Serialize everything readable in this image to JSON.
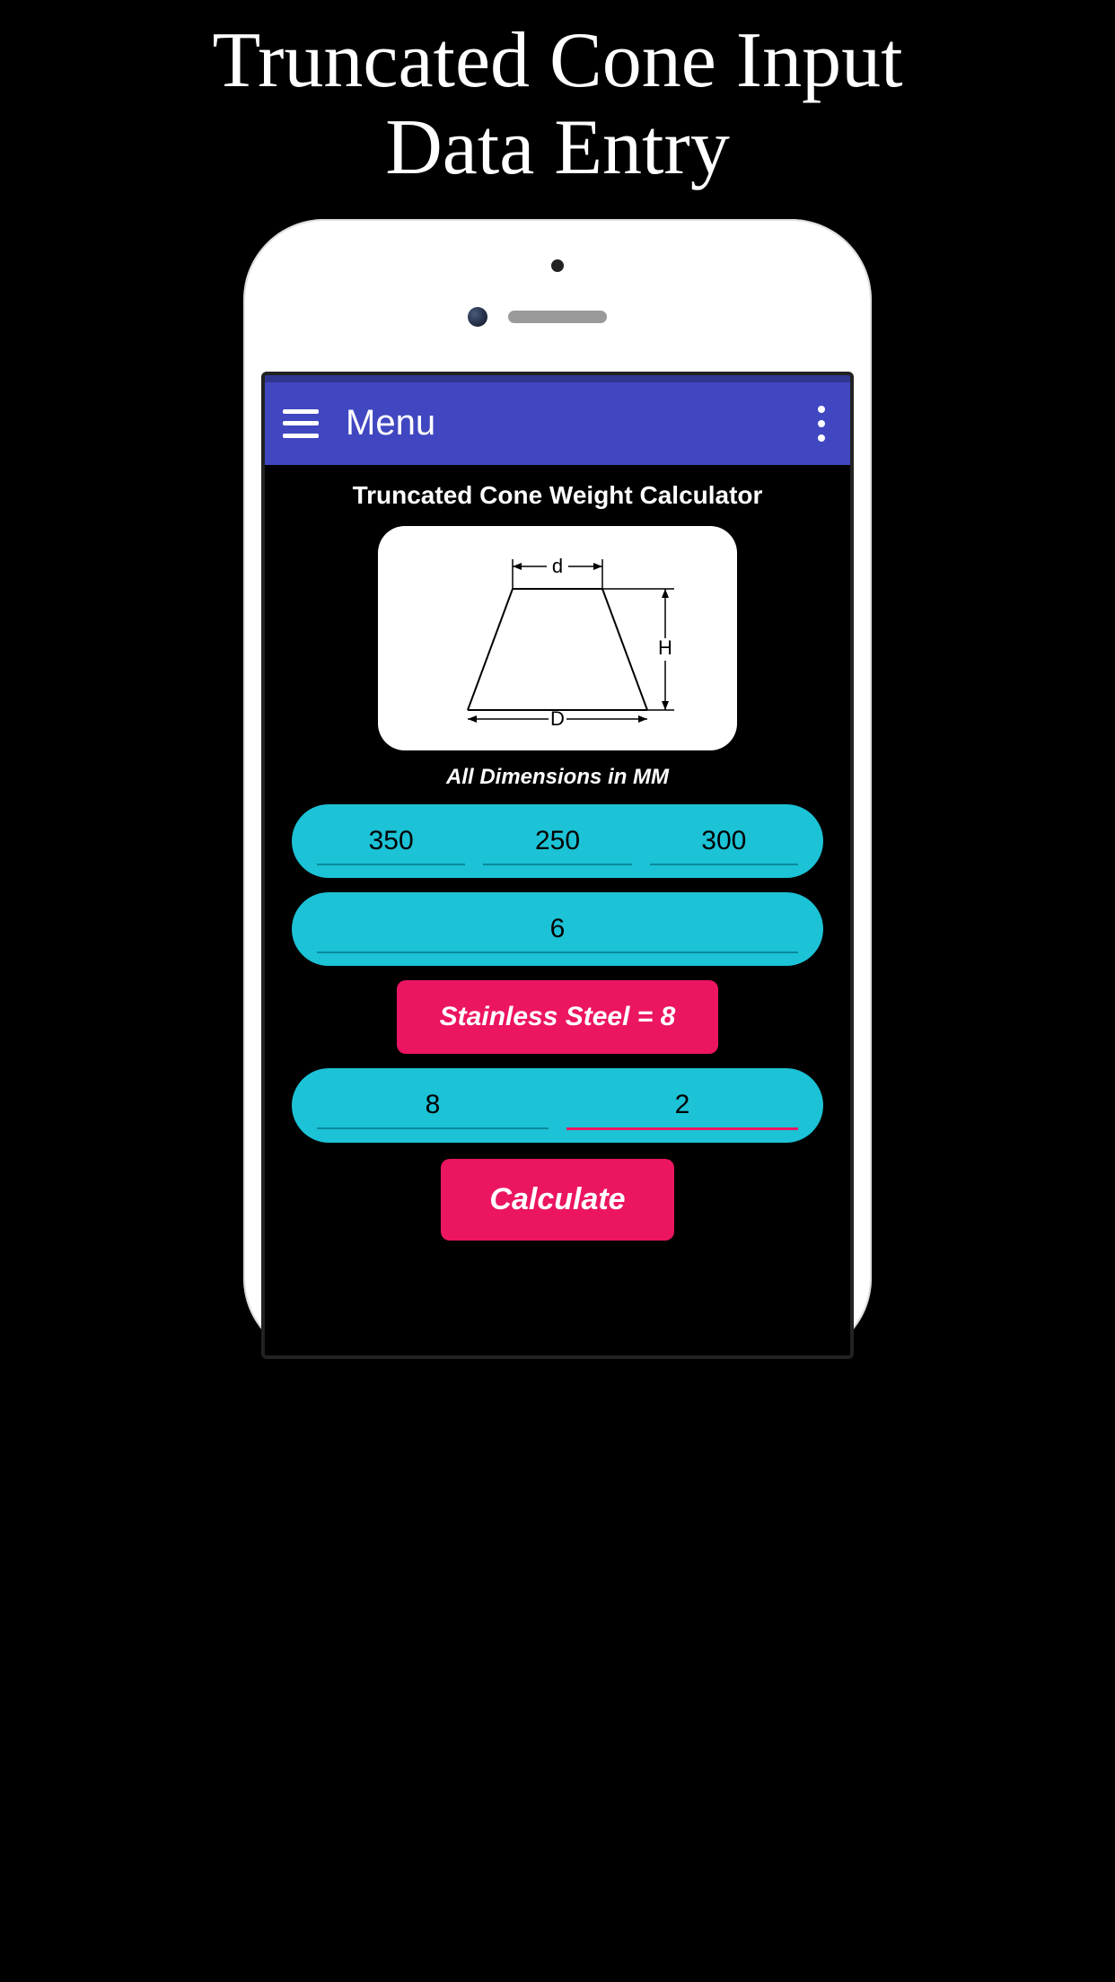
{
  "promo": {
    "title_line1": "Truncated Cone Input",
    "title_line2": "Data Entry"
  },
  "appbar": {
    "title": "Menu"
  },
  "section": {
    "title": "Truncated Cone Weight Calculator",
    "diagram": {
      "d_label": "d",
      "D_label": "D",
      "H_label": "H"
    },
    "units_note": "All Dimensions in MM"
  },
  "inputs": {
    "row1": {
      "d": "350",
      "D": "250",
      "H": "300"
    },
    "thickness": "6",
    "material_label": "Stainless Steel = 8",
    "row3": {
      "density": "8",
      "qty": "2"
    }
  },
  "buttons": {
    "calculate": "Calculate"
  }
}
